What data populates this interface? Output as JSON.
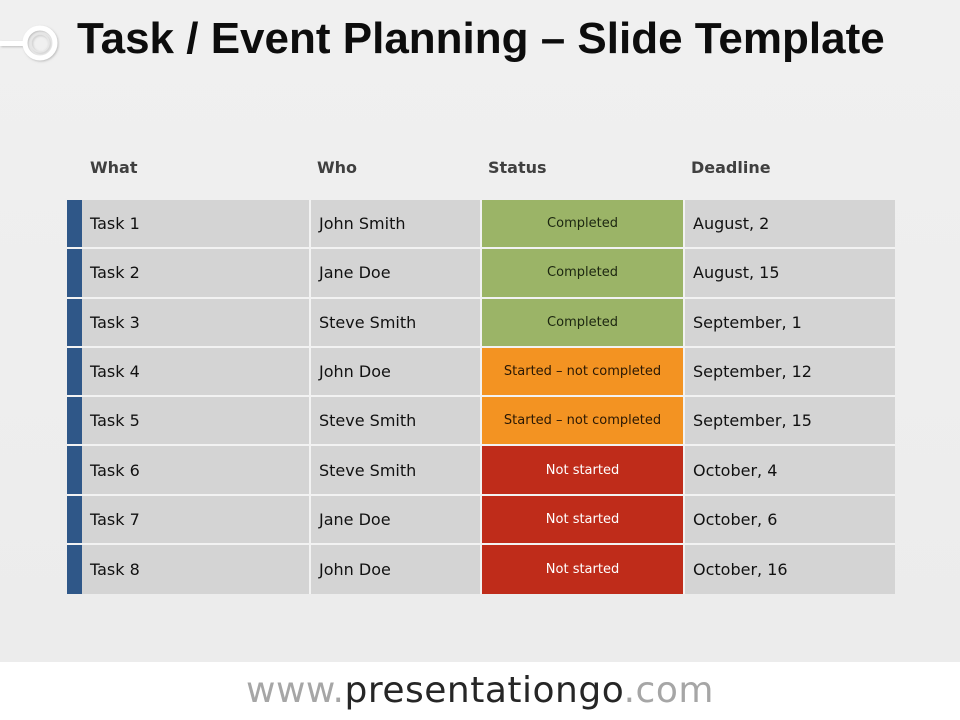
{
  "slide": {
    "title": "Task / Event Planning – Slide Template"
  },
  "table": {
    "headers": [
      "What",
      "Who",
      "Status",
      "Deadline"
    ],
    "rows": [
      {
        "what": "Task 1",
        "who": "John Smith",
        "status": "Completed",
        "status_key": "completed",
        "deadline": "August, 2"
      },
      {
        "what": "Task 2",
        "who": "Jane Doe",
        "status": "Completed",
        "status_key": "completed",
        "deadline": "August, 15"
      },
      {
        "what": "Task 3",
        "who": "Steve Smith",
        "status": "Completed",
        "status_key": "completed",
        "deadline": "September, 1"
      },
      {
        "what": "Task 4",
        "who": "John Doe",
        "status": "Started – not completed",
        "status_key": "started",
        "deadline": "September, 12"
      },
      {
        "what": "Task 5",
        "who": "Steve Smith",
        "status": "Started – not completed",
        "status_key": "started",
        "deadline": "September, 15"
      },
      {
        "what": "Task 6",
        "who": "Steve Smith",
        "status": "Not started",
        "status_key": "notstarted",
        "deadline": "October, 4"
      },
      {
        "what": "Task 7",
        "who": "Jane Doe",
        "status": "Not started",
        "status_key": "notstarted",
        "deadline": "October, 6"
      },
      {
        "what": "Task 8",
        "who": "John Doe",
        "status": "Not started",
        "status_key": "notstarted",
        "deadline": "October, 16"
      }
    ],
    "status_colors": {
      "completed": "#9bb467",
      "started": "#f39322",
      "notstarted": "#bf2c1a"
    },
    "accent_color": "#2f5788"
  },
  "footer": {
    "prefix": "www.",
    "brand": "presentationgo",
    "suffix": ".com"
  }
}
